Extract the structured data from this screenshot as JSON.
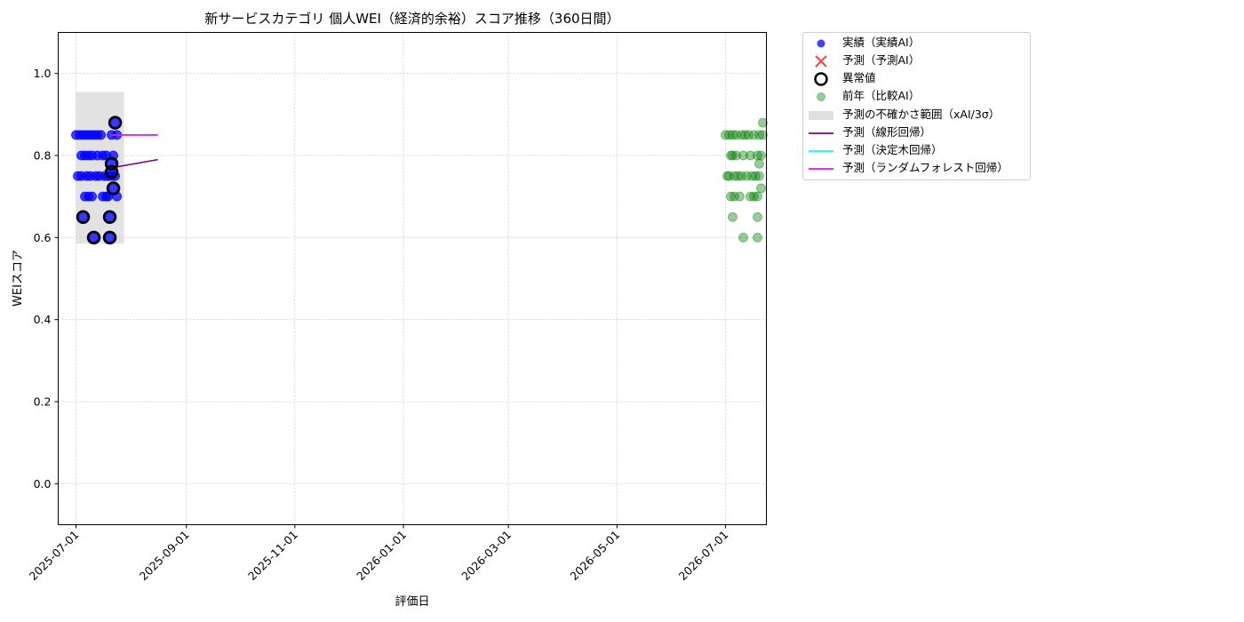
{
  "chart_data": {
    "type": "scatter",
    "title": "新サービスカテゴリ 個人WEI（経済的余裕）スコア推移（360日間）",
    "xlabel": "評価日",
    "ylabel": "WEIスコア",
    "xlim": [
      "2025-06-21",
      "2026-07-24"
    ],
    "ylim": [
      -0.1,
      1.1
    ],
    "x_ticks": [
      "2025-07-01",
      "2025-09-01",
      "2025-11-01",
      "2026-01-01",
      "2026-03-01",
      "2026-05-01",
      "2026-07-01"
    ],
    "y_ticks": [
      0.0,
      0.2,
      0.4,
      0.6,
      0.8,
      1.0
    ],
    "grid": true,
    "legend_position": "outside upper right",
    "uncertainty_band": {
      "name": "予測の不確かさ範囲（xAI/3σ）",
      "x_start": "2025-07-01",
      "x_end": "2025-07-28",
      "y_low": 0.585,
      "y_high": 0.955,
      "color": "#d3d3d3"
    },
    "series": [
      {
        "name": "実績（実績AI）",
        "kind": "scatter",
        "color": "#0000ff",
        "points": [
          {
            "x": "2025-07-01",
            "y": 0.85
          },
          {
            "x": "2025-07-02",
            "y": 0.75
          },
          {
            "x": "2025-07-03",
            "y": 0.85
          },
          {
            "x": "2025-07-04",
            "y": 0.75
          },
          {
            "x": "2025-07-04",
            "y": 0.8
          },
          {
            "x": "2025-07-05",
            "y": 0.65
          },
          {
            "x": "2025-07-05",
            "y": 0.85
          },
          {
            "x": "2025-07-06",
            "y": 0.8
          },
          {
            "x": "2025-07-06",
            "y": 0.7
          },
          {
            "x": "2025-07-07",
            "y": 0.75
          },
          {
            "x": "2025-07-07",
            "y": 0.85
          },
          {
            "x": "2025-07-08",
            "y": 0.8
          },
          {
            "x": "2025-07-08",
            "y": 0.7
          },
          {
            "x": "2025-07-09",
            "y": 0.75
          },
          {
            "x": "2025-07-09",
            "y": 0.85
          },
          {
            "x": "2025-07-10",
            "y": 0.8
          },
          {
            "x": "2025-07-10",
            "y": 0.7
          },
          {
            "x": "2025-07-11",
            "y": 0.6
          },
          {
            "x": "2025-07-11",
            "y": 0.85
          },
          {
            "x": "2025-07-12",
            "y": 0.75
          },
          {
            "x": "2025-07-13",
            "y": 0.8
          },
          {
            "x": "2025-07-13",
            "y": 0.85
          },
          {
            "x": "2025-07-14",
            "y": 0.75
          },
          {
            "x": "2025-07-15",
            "y": 0.85
          },
          {
            "x": "2025-07-16",
            "y": 0.8
          },
          {
            "x": "2025-07-16",
            "y": 0.7
          },
          {
            "x": "2025-07-17",
            "y": 0.75
          },
          {
            "x": "2025-07-18",
            "y": 0.7
          },
          {
            "x": "2025-07-18",
            "y": 0.8
          },
          {
            "x": "2025-07-19",
            "y": 0.75
          },
          {
            "x": "2025-07-19",
            "y": 0.7
          },
          {
            "x": "2025-07-20",
            "y": 0.65
          },
          {
            "x": "2025-07-20",
            "y": 0.6
          },
          {
            "x": "2025-07-21",
            "y": 0.75
          },
          {
            "x": "2025-07-21",
            "y": 0.85
          },
          {
            "x": "2025-07-21",
            "y": 0.78
          },
          {
            "x": "2025-07-21",
            "y": 0.76
          },
          {
            "x": "2025-07-22",
            "y": 0.72
          },
          {
            "x": "2025-07-22",
            "y": 0.8
          },
          {
            "x": "2025-07-23",
            "y": 0.88
          },
          {
            "x": "2025-07-23",
            "y": 0.75
          },
          {
            "x": "2025-07-24",
            "y": 0.85
          },
          {
            "x": "2025-07-24",
            "y": 0.7
          }
        ]
      },
      {
        "name": "予測（予測AI）",
        "kind": "marker-x",
        "color": "#ff0000",
        "points": []
      },
      {
        "name": "異常値",
        "kind": "ring",
        "color": "#000000",
        "points": [
          {
            "x": "2025-07-05",
            "y": 0.65
          },
          {
            "x": "2025-07-11",
            "y": 0.6
          },
          {
            "x": "2025-07-20",
            "y": 0.65
          },
          {
            "x": "2025-07-20",
            "y": 0.6
          },
          {
            "x": "2025-07-21",
            "y": 0.78
          },
          {
            "x": "2025-07-21",
            "y": 0.76
          },
          {
            "x": "2025-07-22",
            "y": 0.72
          },
          {
            "x": "2025-07-23",
            "y": 0.88
          }
        ]
      },
      {
        "name": "前年（比較AI）",
        "kind": "scatter",
        "color": "#008000",
        "points": [
          {
            "x": "2026-07-01",
            "y": 0.85
          },
          {
            "x": "2026-07-02",
            "y": 0.75
          },
          {
            "x": "2026-07-03",
            "y": 0.85
          },
          {
            "x": "2026-07-03",
            "y": 0.75
          },
          {
            "x": "2026-07-04",
            "y": 0.8
          },
          {
            "x": "2026-07-04",
            "y": 0.7
          },
          {
            "x": "2026-07-05",
            "y": 0.85
          },
          {
            "x": "2026-07-05",
            "y": 0.65
          },
          {
            "x": "2026-07-05",
            "y": 0.8
          },
          {
            "x": "2026-07-06",
            "y": 0.75
          },
          {
            "x": "2026-07-06",
            "y": 0.7
          },
          {
            "x": "2026-07-07",
            "y": 0.85
          },
          {
            "x": "2026-07-07",
            "y": 0.8
          },
          {
            "x": "2026-07-08",
            "y": 0.75
          },
          {
            "x": "2026-07-09",
            "y": 0.7
          },
          {
            "x": "2026-07-10",
            "y": 0.75
          },
          {
            "x": "2026-07-10",
            "y": 0.85
          },
          {
            "x": "2026-07-11",
            "y": 0.6
          },
          {
            "x": "2026-07-11",
            "y": 0.8
          },
          {
            "x": "2026-07-12",
            "y": 0.85
          },
          {
            "x": "2026-07-13",
            "y": 0.75
          },
          {
            "x": "2026-07-14",
            "y": 0.85
          },
          {
            "x": "2026-07-15",
            "y": 0.8
          },
          {
            "x": "2026-07-15",
            "y": 0.7
          },
          {
            "x": "2026-07-16",
            "y": 0.75
          },
          {
            "x": "2026-07-17",
            "y": 0.7
          },
          {
            "x": "2026-07-17",
            "y": 0.85
          },
          {
            "x": "2026-07-18",
            "y": 0.75
          },
          {
            "x": "2026-07-19",
            "y": 0.65
          },
          {
            "x": "2026-07-19",
            "y": 0.6
          },
          {
            "x": "2026-07-19",
            "y": 0.8
          },
          {
            "x": "2026-07-19",
            "y": 0.7
          },
          {
            "x": "2026-07-20",
            "y": 0.85
          },
          {
            "x": "2026-07-20",
            "y": 0.78
          },
          {
            "x": "2026-07-20",
            "y": 0.75
          },
          {
            "x": "2026-07-21",
            "y": 0.72
          },
          {
            "x": "2026-07-21",
            "y": 0.8
          },
          {
            "x": "2026-07-22",
            "y": 0.88
          },
          {
            "x": "2026-07-22",
            "y": 0.85
          }
        ]
      },
      {
        "name": "予測（線形回帰）",
        "kind": "line",
        "color": "#800080",
        "points": [
          {
            "x": "2025-07-21",
            "y": 0.77
          },
          {
            "x": "2025-08-16",
            "y": 0.79
          }
        ]
      },
      {
        "name": "予測（決定木回帰）",
        "kind": "line",
        "color": "#00ffff",
        "points": [
          {
            "x": "2025-07-21",
            "y": 0.85
          },
          {
            "x": "2025-08-16",
            "y": 0.85
          }
        ]
      },
      {
        "name": "予測（ランダムフォレスト回帰）",
        "kind": "line",
        "color": "#ff00ff",
        "points": [
          {
            "x": "2025-07-21",
            "y": 0.85
          },
          {
            "x": "2025-08-16",
            "y": 0.85
          }
        ]
      }
    ]
  }
}
